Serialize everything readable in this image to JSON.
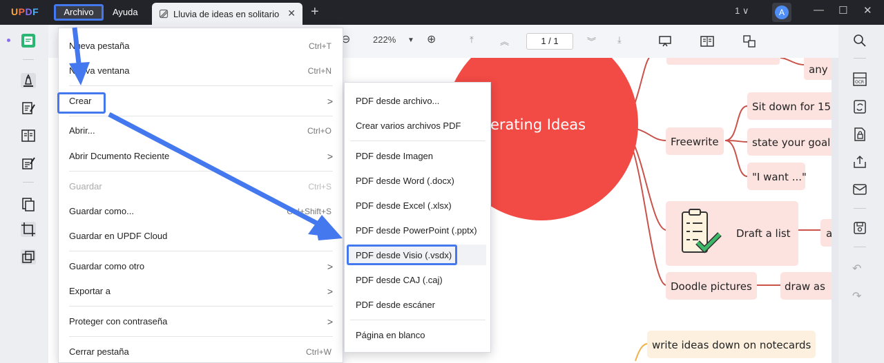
{
  "app": {
    "logo": "UPDF",
    "logo_colors": [
      "#f6a53b",
      "#f06a4a",
      "#8a6cf0",
      "#4fb0f7"
    ]
  },
  "menubar": {
    "file": "Archivo",
    "help": "Ayuda"
  },
  "tab": {
    "title": "Lluvia de ideas en solitario",
    "close": "✕",
    "add": "+"
  },
  "titlebar": {
    "page_count": "1 ∨",
    "avatar_letter": "A",
    "minimize": "—",
    "maximize": "☐",
    "close": "✕"
  },
  "toolbar": {
    "zoom": "222%",
    "page_input": "1 / 1"
  },
  "file_menu": {
    "items": [
      {
        "label": "Nueva pestaña",
        "shortcut": "Ctrl+T"
      },
      {
        "label": "Nueva ventana",
        "shortcut": "Ctrl+N"
      },
      {
        "label": "Crear",
        "submenu": true
      },
      {
        "label": "Abrir...",
        "shortcut": "Ctrl+O"
      },
      {
        "label": "Abrir Dcumento Reciente",
        "submenu": true
      },
      {
        "label": "Guardar",
        "shortcut": "Ctrl+S",
        "disabled": true
      },
      {
        "label": "Guardar como...",
        "shortcut": "Ctrl+Shift+S"
      },
      {
        "label": "Guardar en UPDF Cloud"
      },
      {
        "label": "Guardar como otro",
        "submenu": true
      },
      {
        "label": "Exportar a",
        "submenu": true
      },
      {
        "label": "Proteger con contraseña",
        "submenu": true
      },
      {
        "label": "Cerrar pestaña",
        "shortcut": "Ctrl+W"
      }
    ]
  },
  "create_submenu": {
    "items": [
      "PDF desde archivo...",
      "Crear varios archivos PDF",
      "PDF desde Imagen",
      "PDF desde Word (.docx)",
      "PDF desde Excel (.xlsx)",
      "PDF desde PowerPoint (.pptx)",
      "PDF desde Visio (.vsdx)",
      "PDF desde CAJ (.caj)",
      "PDF desde escáner",
      "Página en blanco"
    ]
  },
  "mindmap": {
    "center": "erating Ideas",
    "node_any": "any",
    "node_freewrite": "Freewrite",
    "node_sitdown": "Sit down for 15",
    "node_goal": "state your goal",
    "node_iwant": "\"I want ...\"",
    "node_draft": "Draft a list",
    "node_a": "a",
    "node_doodle": "Doodle pictures",
    "node_drawas": "draw as",
    "node_notecards": "write ideas down on notecards",
    "center_color": "#f24a45",
    "node_fill": "#fde3e0",
    "line_color": "#c9524a"
  },
  "icons": {
    "left_sidebar": [
      "reader-icon",
      "highlighter-icon",
      "edit-icon",
      "reader-mode-icon",
      "form-icon",
      "pages-icon",
      "crop-icon",
      "layers-icon"
    ],
    "right_sidebar": [
      "search-icon",
      "ocr-icon",
      "convert-icon",
      "protect-icon",
      "share-icon",
      "mail-icon",
      "save-icon",
      "undo-icon",
      "redo-icon"
    ]
  }
}
